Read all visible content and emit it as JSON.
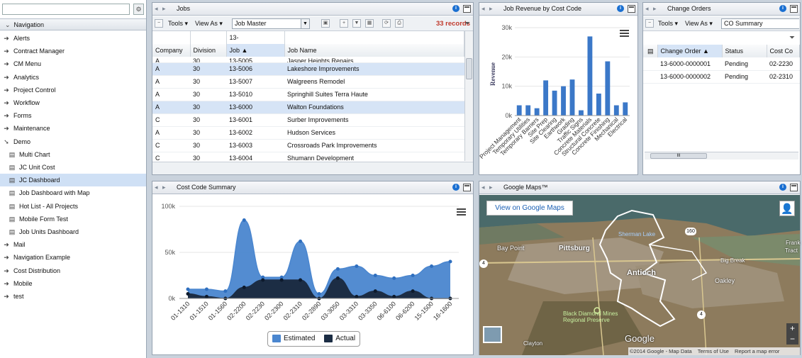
{
  "nav": {
    "header": "Navigation",
    "items": [
      {
        "label": "Alerts",
        "icon": "arrow-icon",
        "level": 0
      },
      {
        "label": "Contract Manager",
        "icon": "arrow-icon",
        "level": 0
      },
      {
        "label": "CM Menu",
        "icon": "arrow-icon",
        "level": 0
      },
      {
        "label": "Analytics",
        "icon": "arrow-icon",
        "level": 0
      },
      {
        "label": "Project Control",
        "icon": "arrow-icon",
        "level": 0
      },
      {
        "label": "Workflow",
        "icon": "arrow-icon",
        "level": 0
      },
      {
        "label": "Forms",
        "icon": "arrow-icon",
        "level": 0
      },
      {
        "label": "Maintenance",
        "icon": "arrow-icon",
        "level": 0
      },
      {
        "label": "Demo",
        "icon": "arrow-open-icon",
        "level": 0
      },
      {
        "label": "Multi Chart",
        "icon": "page-icon",
        "level": 1
      },
      {
        "label": "JC Unit Cost",
        "icon": "page-icon",
        "level": 1
      },
      {
        "label": "JC Dashboard",
        "icon": "page-icon",
        "level": 1,
        "selected": true
      },
      {
        "label": "Job Dashboard with Map",
        "icon": "page-icon",
        "level": 1
      },
      {
        "label": "Hot List - All Projects",
        "icon": "page-icon",
        "level": 1
      },
      {
        "label": "Mobile Form Test",
        "icon": "page-icon",
        "level": 1
      },
      {
        "label": "Job Units Dashboard",
        "icon": "page-icon",
        "level": 1
      },
      {
        "label": "Mail",
        "icon": "arrow-icon",
        "level": 0
      },
      {
        "label": "Navigation Example",
        "icon": "arrow-icon",
        "level": 0
      },
      {
        "label": "Cost Distribution",
        "icon": "arrow-icon",
        "level": 0
      },
      {
        "label": "Mobile",
        "icon": "arrow-icon",
        "level": 0
      },
      {
        "label": "test",
        "icon": "arrow-icon",
        "level": 0
      }
    ]
  },
  "jobs": {
    "title": "Jobs",
    "tools": "Tools",
    "view_as": "View As",
    "view": "Job Master",
    "records": "33 records",
    "group_value": "13-",
    "columns": [
      "Company",
      "Division",
      "Job",
      "Job Name"
    ],
    "partial_row": [
      "A",
      "30",
      "13-5005",
      "Jasper Heights Repairs"
    ],
    "rows": [
      [
        "A",
        "30",
        "13-5006",
        "Lakeshore Improvements"
      ],
      [
        "A",
        "30",
        "13-5007",
        "Walgreens Remodel"
      ],
      [
        "A",
        "30",
        "13-5010",
        "Springhill Suites Terra Haute"
      ],
      [
        "A",
        "30",
        "13-6000",
        "Walton Foundations"
      ],
      [
        "C",
        "30",
        "13-6001",
        "Surber Improvements"
      ],
      [
        "A",
        "30",
        "13-6002",
        "Hudson Services"
      ],
      [
        "C",
        "30",
        "13-6003",
        "Crossroads Park Improvements"
      ],
      [
        "C",
        "30",
        "13-6004",
        "Shumann Development"
      ]
    ]
  },
  "revenue": {
    "title": "Job Revenue by Cost Code"
  },
  "change_orders": {
    "title": "Change Orders",
    "tools": "Tools",
    "view_as": "View As",
    "view": "CO Summary",
    "columns": [
      "Change Order",
      "Status",
      "Cost Co"
    ],
    "rows": [
      [
        "13-6000-0000001",
        "Pending",
        "02-2230"
      ],
      [
        "13-6000-0000002",
        "Pending",
        "02-2310"
      ]
    ]
  },
  "cost_summary": {
    "title": "Cost Code Summary"
  },
  "maps": {
    "title": "Google Maps™",
    "view_link": "View on Google Maps",
    "labels": {
      "pittsburg": "Pittsburg",
      "bay_point": "Bay Point",
      "antioch": "Antioch",
      "oakley": "Oakley",
      "sherman": "Sherman Lake",
      "big_break": "Big Break",
      "black_diamond": "Black Diamond Mines Regional Preserve",
      "clayton": "Clayton",
      "frank": "Frank",
      "tract": "Tract",
      "google": "Google"
    },
    "route_badges": [
      "4",
      "4",
      "160"
    ],
    "footer": "©2014 Google - Map Data",
    "terms": "Terms of Use",
    "report": "Report a map error",
    "zoom_in": "+",
    "zoom_out": "−",
    "colors": {
      "land": "#8d7b5d",
      "water": "#4a6a6a",
      "route": "#ffffff"
    }
  },
  "chart_data": [
    {
      "type": "bar",
      "title": "",
      "ylabel": "Revenue",
      "xlabel": "",
      "ylim": [
        0,
        30000
      ],
      "yticks": [
        "0k",
        "10k",
        "20k",
        "30k"
      ],
      "categories": [
        "Project Management",
        "Temporary Utilities",
        "Temporary Barriers",
        "Site Prep",
        "Site Clearing",
        "Earthwork",
        "Grading",
        "Traffic Signs",
        "Concrete Materials",
        "Structural Concrete",
        "Concrete Finishing",
        "Mechanical",
        "Electrical"
      ],
      "values": [
        3500,
        3500,
        2500,
        12000,
        8500,
        10000,
        12300,
        1800,
        27000,
        7500,
        18500,
        3500,
        4500
      ],
      "color": "#3b78c8"
    },
    {
      "type": "area",
      "title": "",
      "ylim": [
        0,
        100000
      ],
      "yticks": [
        "0k",
        "50k",
        "100k"
      ],
      "categories": [
        "01-1310",
        "01-1510",
        "01-1560",
        "02-2200",
        "02-2230",
        "02-2300",
        "02-2310",
        "02-2890",
        "03-3050",
        "03-3310",
        "03-3350",
        "06-6100",
        "06-6200",
        "15-1500",
        "16-1600"
      ],
      "series": [
        {
          "name": "Estimated",
          "color": "#4a86cf",
          "values": [
            10000,
            10000,
            8000,
            85000,
            23000,
            23000,
            62000,
            5000,
            32000,
            35000,
            25000,
            22000,
            25000,
            35000,
            40000
          ]
        },
        {
          "name": "Actual",
          "color": "#1c2d44",
          "values": [
            5000,
            2000,
            0,
            12000,
            20000,
            20000,
            20000,
            0,
            22000,
            2000,
            8000,
            2000,
            8000,
            0,
            0
          ]
        }
      ]
    }
  ]
}
